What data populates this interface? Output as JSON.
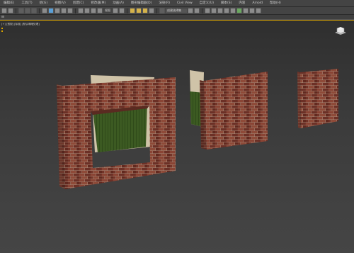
{
  "menubar": {
    "items": [
      "编辑(E)",
      "工具(T)",
      "组(G)",
      "视图(V)",
      "创建(C)",
      "修改器(M)",
      "动画(A)",
      "图形编辑器(D)",
      "渲染(R)",
      "Civil View",
      "自定义(U)",
      "脚本(S)",
      "内容",
      "Arnold",
      "帮助(H)"
    ]
  },
  "toolbar": {
    "view_dropdown": "视图",
    "view_dropdown_icon": "view-mode-icon",
    "selection_set_placeholder": "创建选择集"
  },
  "viewport": {
    "label": "[+] [透视] [标准] [默认明暗处理]",
    "scene_objects": [
      "brick-wall-with-window",
      "brick-wall-with-partition",
      "brick-wall-small"
    ],
    "colors": {
      "brick": "#7a3a2e",
      "mortar": "#a88d7b",
      "plaster": "#cfc3a8",
      "green_paint": "#3c5a22",
      "active_border": "#d9a400"
    }
  }
}
